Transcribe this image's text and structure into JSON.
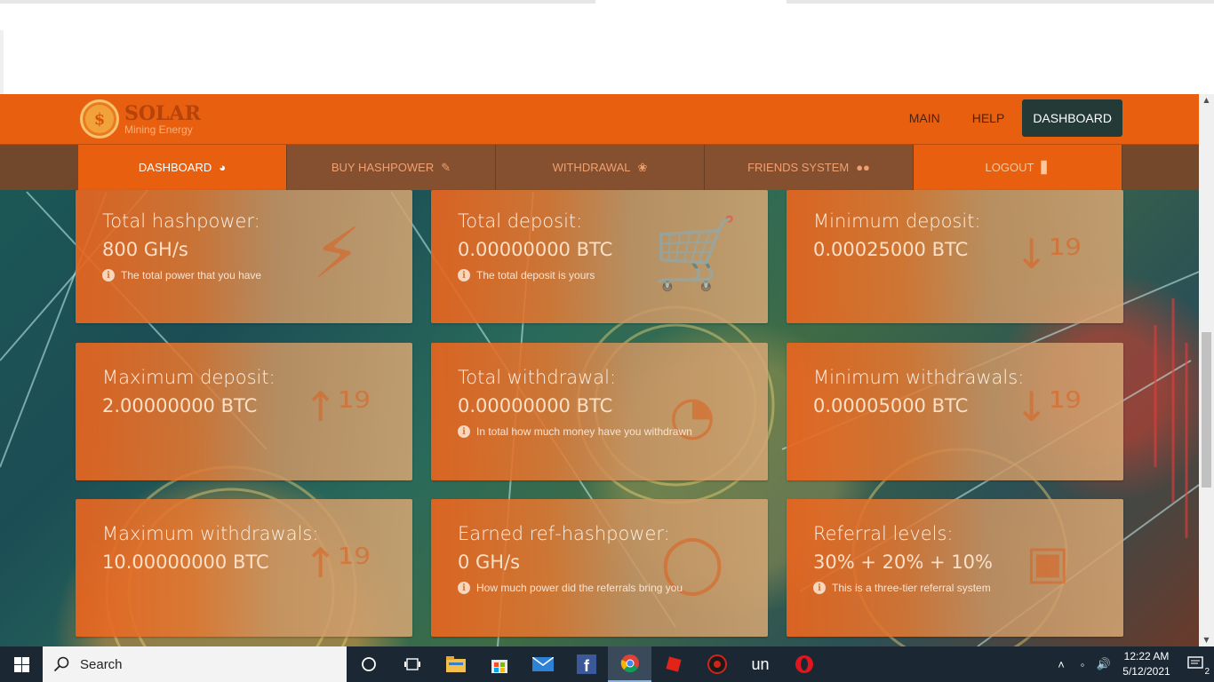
{
  "header": {
    "logo_title": "SOLAR",
    "logo_subtitle": "Mining Energy",
    "logo_symbol": "$",
    "nav": [
      {
        "label": "MAIN"
      },
      {
        "label": "HELP"
      },
      {
        "label": "DASHBOARD",
        "active": true
      }
    ]
  },
  "subnav": [
    {
      "label": "DASHBOARD",
      "icon": "dashboard-icon",
      "active": true
    },
    {
      "label": "BUY HASHPOWER",
      "icon": "edit-icon"
    },
    {
      "label": "WITHDRAWAL",
      "icon": "hands-coin-icon"
    },
    {
      "label": "FRIENDS SYSTEM",
      "icon": "users-icon"
    },
    {
      "label": "LOGOUT",
      "icon": "door-exit-icon"
    }
  ],
  "cards": [
    {
      "title": "Total hashpower:",
      "value": "800 GH/s",
      "note": "The total power that you have",
      "icon": "lightning-icon"
    },
    {
      "title": "Total deposit:",
      "value": "0.00000000 BTC",
      "note": "The total deposit is yours",
      "icon": "cart-plus-icon"
    },
    {
      "title": "Minimum deposit:",
      "value": "0.00025000 BTC",
      "note": "",
      "icon": "sort-numeric-down-icon"
    },
    {
      "title": "Maximum deposit:",
      "value": "2.00000000 BTC",
      "note": "",
      "icon": "sort-numeric-up-icon"
    },
    {
      "title": "Total withdrawal:",
      "value": "0.00000000 BTC",
      "note": "In total how much money have you withdrawn",
      "icon": "dollar-coin-icon"
    },
    {
      "title": "Minimum withdrawals:",
      "value": "0.00005000 BTC",
      "note": "",
      "icon": "sort-numeric-down-icon"
    },
    {
      "title": "Maximum withdrawals:",
      "value": "10.00000000 BTC",
      "note": "",
      "icon": "sort-numeric-up-icon"
    },
    {
      "title": "Earned ref-hashpower:",
      "value": "0 GH/s",
      "note": "How much power did the referrals bring you",
      "icon": "network-circle-icon"
    },
    {
      "title": "Referral levels:",
      "value": "30% + 20% + 10%",
      "note": "This is a three-tier referral system",
      "icon": "presentation-users-icon"
    }
  ],
  "taskbar": {
    "search_placeholder": "Search",
    "apps": [
      {
        "icon": "cortana-icon"
      },
      {
        "icon": "task-view-icon"
      },
      {
        "icon": "file-explorer-icon"
      },
      {
        "icon": "store-icon"
      },
      {
        "icon": "mail-icon"
      },
      {
        "icon": "facebook-icon"
      },
      {
        "icon": "chrome-icon",
        "active": true
      },
      {
        "icon": "roblox-icon"
      },
      {
        "icon": "app-red-icon"
      },
      {
        "icon": "un-app-icon",
        "label": "un"
      },
      {
        "icon": "opera-icon"
      }
    ],
    "time": "12:22 AM",
    "date": "5/12/2021",
    "notification_count": "2"
  },
  "colors": {
    "brand_orange": "#e85f10",
    "header_active": "#243a36",
    "subnav_bg": "#84502f",
    "taskbar": "#1b2733"
  }
}
